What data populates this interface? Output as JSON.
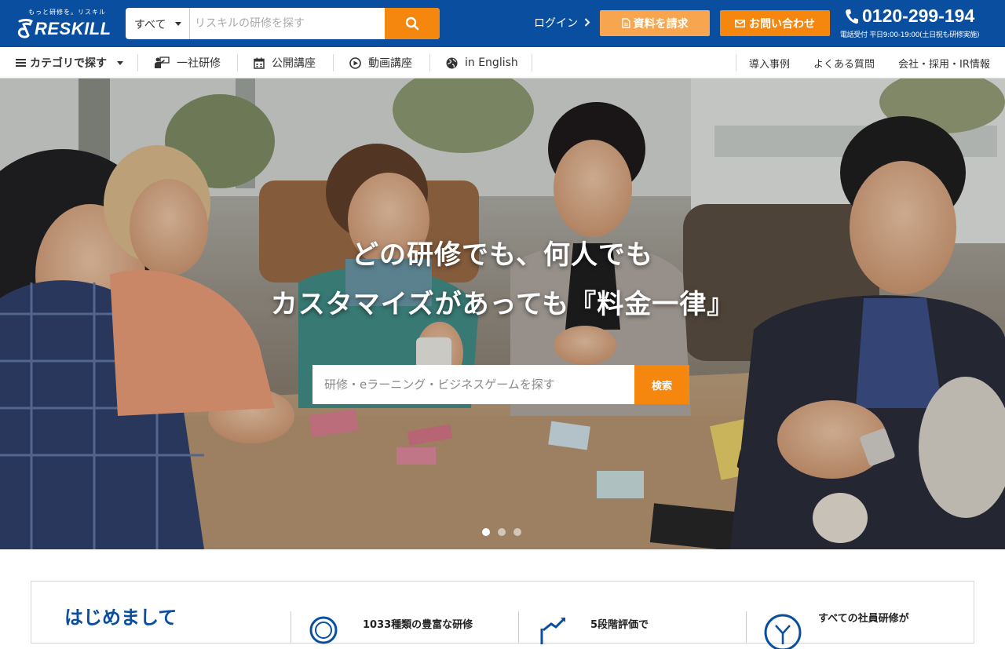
{
  "header": {
    "logo_tagline": "もっと研修を。リスキル",
    "logo_text": "RESKILL",
    "search": {
      "category_selected": "すべて",
      "placeholder": "リスキルの研修を探す"
    },
    "login_label": "ログイン",
    "docs_button_label": "資料を請求",
    "contact_button_label": "お問い合わせ",
    "phone_number": "0120-299-194",
    "phone_hours": "電話受付 平日9:00-19:00(土日祝も研修実施)"
  },
  "nav": {
    "left": [
      {
        "label": "カテゴリで探す",
        "icon": "menu-icon"
      },
      {
        "label": "一社研修",
        "icon": "presentation-icon"
      },
      {
        "label": "公開講座",
        "icon": "calendar-icon"
      },
      {
        "label": "動画講座",
        "icon": "play-circle-icon"
      },
      {
        "label": "in English",
        "icon": "globe-icon"
      }
    ],
    "right": [
      {
        "label": "導入事例"
      },
      {
        "label": "よくある質問"
      },
      {
        "label": "会社・採用・IR情報"
      }
    ]
  },
  "hero": {
    "headline_line1": "どの研修でも、何人でも",
    "headline_line2": "カスタマイズがあっても『料金一律』",
    "search_placeholder": "研修・eラーニング・ビジネスゲームを探す",
    "search_button_label": "検索",
    "slide_count": 3,
    "active_slide": 1
  },
  "intro": {
    "title": "はじめまして",
    "features": [
      {
        "text": "1033種類の豊富な研修",
        "icon": "search-icon"
      },
      {
        "text": "5段階評価で",
        "icon": "rating-chart-icon"
      },
      {
        "text": "すべての社員研修が",
        "icon": "yen-icon"
      }
    ]
  },
  "colors": {
    "header_blue": "#0a4f9f",
    "accent_orange": "#f5870f",
    "light_orange": "#f7a54f"
  }
}
